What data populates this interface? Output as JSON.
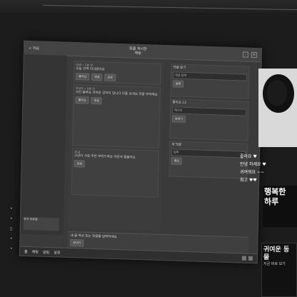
{
  "window": {
    "back_label": "< 커뮤",
    "title_line1": "동물 게시판",
    "title_line2": "채팅"
  },
  "left_sidebar": {
    "thumb_label": "유저 프로필"
  },
  "feed": {
    "posts": [
      {
        "meta": "안녕 • 1분 전",
        "body": "오늘 산책 다녀왔어요",
        "buttons": [
          "좋아요",
          "댓글",
          "공유"
        ]
      },
      {
        "meta": "작성자 • 5분 전",
        "body": "사진 올려요 귀여운 강아지 입니다 다들 보세요 댓글 부탁해요",
        "buttons": [
          "좋아요",
          "댓글"
        ]
      },
      {
        "meta": "새 글",
        "body": "고양이 사료 추천 부탁드려요 어떤게 좋을까요",
        "buttons": [
          "답글"
        ]
      }
    ]
  },
  "right_panel": {
    "items": [
      {
        "label": "댓글 달기",
        "input": "댓글 입력",
        "button": "등록"
      },
      {
        "label": "좋아요 12",
        "input": "메시지",
        "button": "보내기"
      },
      {
        "label": "새 댓글",
        "input": "입력",
        "button": "확인"
      }
    ]
  },
  "compose": {
    "text": "새 글 작성 또는 댓글을 입력하세요",
    "button": "보내기"
  },
  "bottombar": {
    "items": [
      "홈",
      "채팅",
      "알림",
      "설정"
    ]
  },
  "overlay": {
    "chat_lines": [
      "좋아요 ♥",
      "안녕 하세요 ♥",
      "귀여워요 ~~",
      "최고 ♥♥"
    ],
    "banner": "행복한 하루",
    "promo_title": "귀여운 동물",
    "promo_sub": "지금 바로 보기"
  }
}
